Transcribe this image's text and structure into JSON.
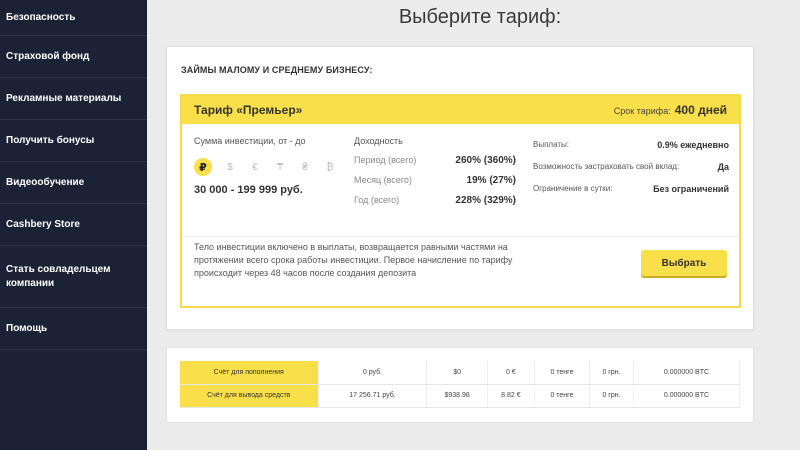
{
  "sidebar": {
    "items": [
      {
        "label": "Безопасность"
      },
      {
        "label": "Страховой фонд"
      },
      {
        "label": "Рекламные материалы"
      },
      {
        "label": "Получить бонусы"
      },
      {
        "label": "Видеообучение"
      },
      {
        "label": "Cashbery Store"
      },
      {
        "label": "Стать совладельцем компании"
      },
      {
        "label": "Помощь"
      }
    ]
  },
  "page_title": "Выберите тариф:",
  "card": {
    "heading": "ЗАЙМЫ МАЛОМУ И СРЕДНЕМУ БИЗНЕСУ:",
    "tariff": {
      "name": "Тариф «Премьер»",
      "term_label": "Срок тарифа:",
      "term_value": "400 дней",
      "investment_label": "Сумма инвестиции, от - до",
      "currencies": [
        "₽",
        "$",
        "€",
        "₸",
        "₴",
        "₿"
      ],
      "amount_range": "30 000 - 199 999 руб.",
      "yield_label": "Доходность",
      "yield_rows": [
        {
          "k": "Период (всего)",
          "v": "260% (360%)"
        },
        {
          "k": "Месяц (всего)",
          "v": "19% (27%)"
        },
        {
          "k": "Год (всего)",
          "v": "228% (329%)"
        }
      ],
      "info_rows": [
        {
          "k": "Выплаты:",
          "v": "0.9% ежедневно"
        },
        {
          "k": "Возможность застраховать свой вклад:",
          "v": "Да"
        },
        {
          "k": "Ограничение в сутки:",
          "v": "Без ограничений"
        }
      ],
      "description": "Тело инвестиции включено в выплаты, возвращается равными частями на протяжении всего срока работы инвестиции. Первое начисление по тарифу происходит через 48 часов после создания депозита",
      "choose_label": "Выбрать"
    }
  },
  "accounts": {
    "rows": [
      {
        "label": "Счёт для пополнения",
        "values": [
          "0 руб.",
          "$0",
          "0 €",
          "0 тенге",
          "0 грн.",
          "0.000000 BTC"
        ]
      },
      {
        "label": "Счёт для вывода средств",
        "values": [
          "17 256.71 руб.",
          "$938.98",
          "8.82 €",
          "0 тенге",
          "0 грн.",
          "0.000000 BTC"
        ]
      }
    ]
  },
  "colors": {
    "sidebar_bg": "#1b2235",
    "accent_yellow": "#f9df4a"
  }
}
